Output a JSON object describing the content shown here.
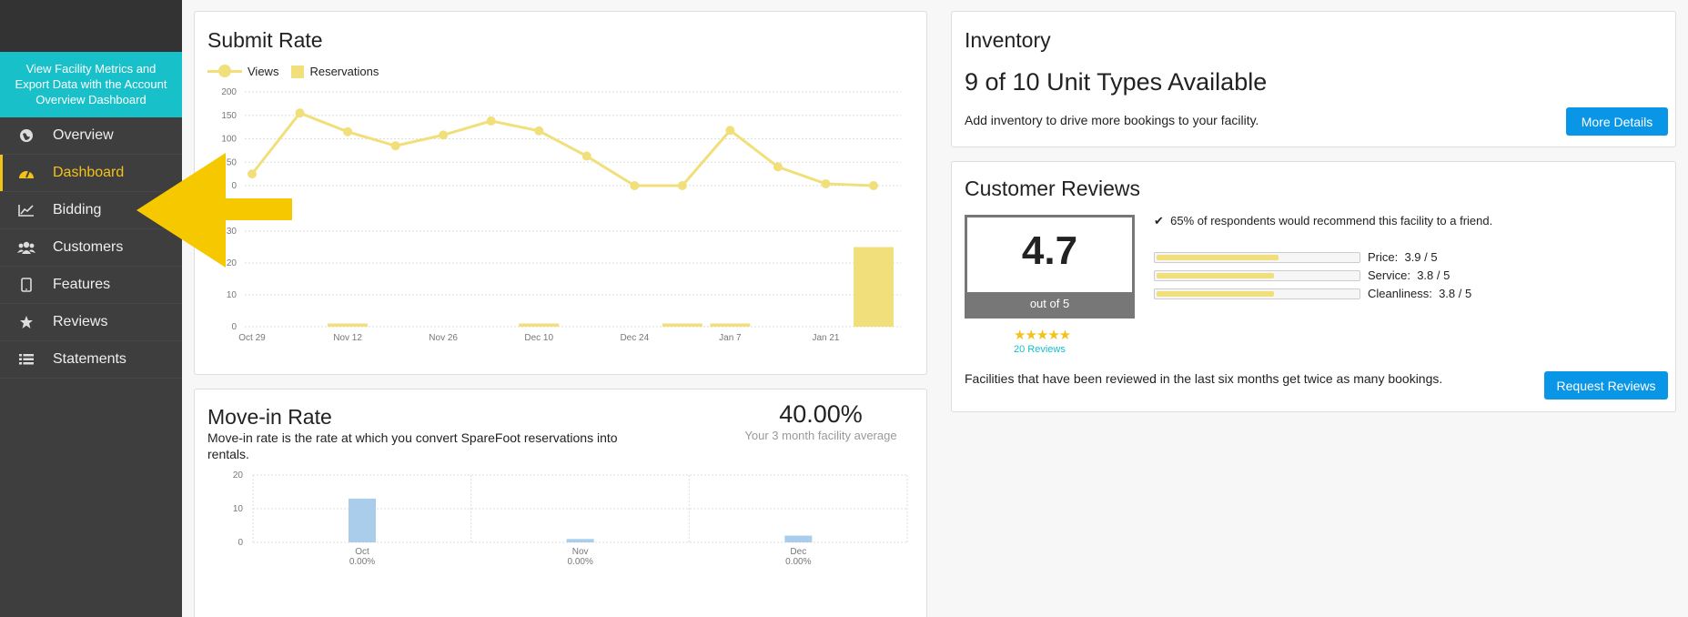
{
  "sidebar": {
    "promo_text": "View Facility Metrics and Export Data with the Account Overview Dashboard",
    "items": [
      {
        "label": "Overview",
        "icon": "globe-icon"
      },
      {
        "label": "Dashboard",
        "icon": "dashboard-gauge-icon"
      },
      {
        "label": "Bidding",
        "icon": "line-chart-icon"
      },
      {
        "label": "Customers",
        "icon": "users-icon"
      },
      {
        "label": "Features",
        "icon": "tablet-icon"
      },
      {
        "label": "Reviews",
        "icon": "star-icon"
      },
      {
        "label": "Statements",
        "icon": "list-icon"
      }
    ],
    "active_index": 1,
    "accent": "#f3c21a"
  },
  "submit_rate": {
    "title": "Submit Rate",
    "legend": {
      "views": "Views",
      "reservations": "Reservations"
    },
    "color": "#f0df7a"
  },
  "move_in": {
    "title": "Move-in Rate",
    "description": "Move-in rate is the rate at which you convert SpareFoot reservations into rentals.",
    "average_value": "40.00%",
    "average_label": "Your 3 month facility average",
    "color": "#a9cdea"
  },
  "inventory": {
    "title": "Inventory",
    "headline": "9 of 10 Unit Types Available",
    "description": "Add inventory to drive more bookings to your facility.",
    "button_label": "More Details"
  },
  "reviews": {
    "title": "Customer Reviews",
    "score": "4.7",
    "score_sub": "out of 5",
    "stars": "★★★★★",
    "count_label": "20 Reviews",
    "recommend_text": "65% of respondents would recommend this facility to a friend.",
    "breakdown": [
      {
        "label": "Price:",
        "value": "3.9 / 5",
        "score": 3.9
      },
      {
        "label": "Service:",
        "value": "3.8 / 5",
        "score": 3.8
      },
      {
        "label": "Cleanliness:",
        "value": "3.8 / 5",
        "score": 3.8
      }
    ],
    "footer_text": "Facilities that have been reviewed in the last six months get twice as many bookings.",
    "button_label": "Request Reviews"
  },
  "chart_data": [
    {
      "type": "line",
      "name": "Views",
      "x": [
        "Oct 29",
        "Nov 5",
        "Nov 12",
        "Nov 19",
        "Nov 26",
        "Dec 3",
        "Dec 10",
        "Dec 17",
        "Dec 24",
        "Dec 31",
        "Jan 7",
        "Jan 14",
        "Jan 21",
        "Jan 28"
      ],
      "values": [
        25,
        155,
        115,
        85,
        108,
        138,
        117,
        63,
        0,
        0,
        118,
        40,
        4,
        0
      ],
      "ylim": [
        0,
        200
      ],
      "yticks": [
        0,
        50,
        100,
        150,
        200
      ],
      "xtick_labels": [
        "Oct 29",
        "Nov 12",
        "Nov 26",
        "Dec 10",
        "Dec 24",
        "Jan 7",
        "Jan 21"
      ],
      "grid": true
    },
    {
      "type": "bar",
      "name": "Reservations",
      "x": [
        "Oct 29",
        "Nov 5",
        "Nov 12",
        "Nov 19",
        "Nov 26",
        "Dec 3",
        "Dec 10",
        "Dec 17",
        "Dec 24",
        "Dec 31",
        "Jan 7",
        "Jan 14",
        "Jan 21",
        "Jan 28"
      ],
      "values": [
        0,
        0,
        1,
        0,
        0,
        0,
        1,
        0,
        0,
        1,
        1,
        0,
        0,
        25
      ],
      "ylim": [
        0,
        30
      ],
      "yticks": [
        0,
        10,
        20,
        30
      ],
      "grid": true
    },
    {
      "type": "bar",
      "categories": [
        "Oct",
        "Nov",
        "Dec"
      ],
      "category_sublabels": [
        "0.00%",
        "0.00%",
        "0.00%"
      ],
      "values": [
        13,
        1,
        2
      ],
      "ylim": [
        0,
        20
      ],
      "yticks": [
        0,
        10,
        20
      ],
      "grid": true
    }
  ]
}
